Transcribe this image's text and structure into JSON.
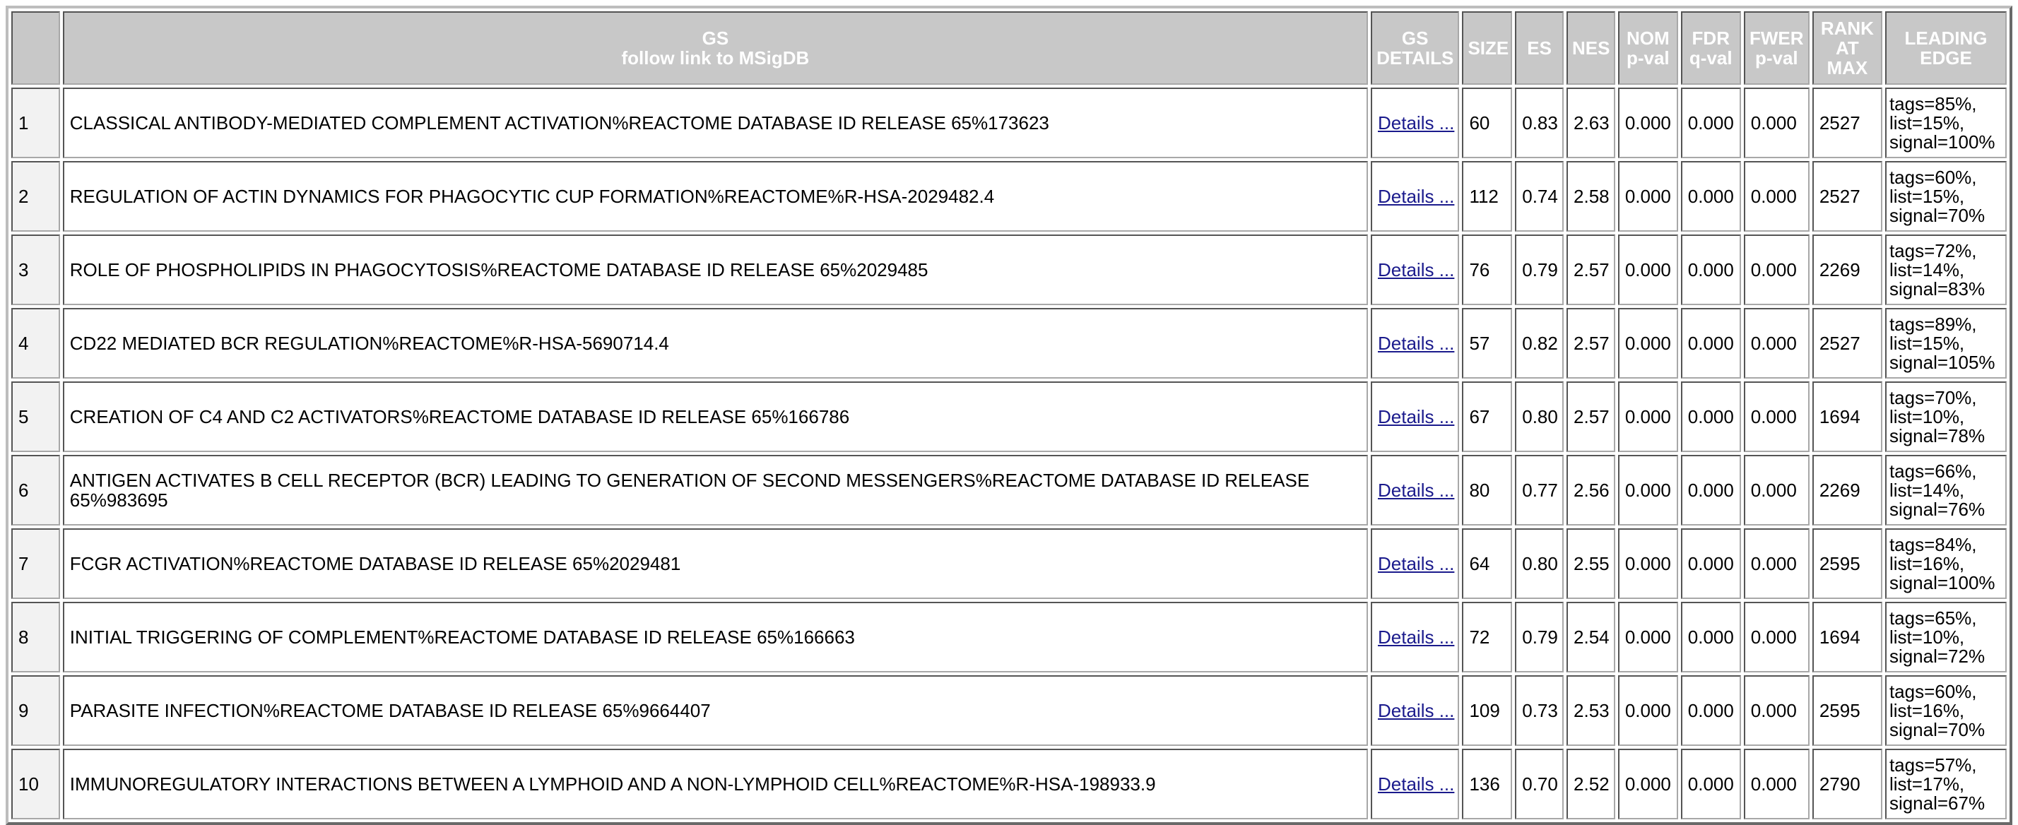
{
  "header": {
    "gs_line1": "GS",
    "gs_line2": "follow link to MSigDB",
    "details_line1": "GS",
    "details_line2": "DETAILS",
    "size": "SIZE",
    "es": "ES",
    "nes": "NES",
    "nom_line1": "NOM",
    "nom_line2": "p-val",
    "fdr_line1": "FDR",
    "fdr_line2": "q-val",
    "fwer_line1": "FWER",
    "fwer_line2": "p-val",
    "rank_line1": "RANK",
    "rank_line2": "AT",
    "rank_line3": "MAX",
    "edge_line1": "LEADING",
    "edge_line2": "EDGE"
  },
  "details_label": "Details ...",
  "rows": [
    {
      "rank": "1",
      "gs": "CLASSICAL ANTIBODY-MEDIATED COMPLEMENT ACTIVATION%REACTOME DATABASE ID RELEASE 65%173623",
      "size": "60",
      "es": "0.83",
      "nes": "2.63",
      "nom": "0.000",
      "fdr": "0.000",
      "fwer": "0.000",
      "rank_at_max": "2527",
      "tags": "tags=85%,",
      "list": "list=15%,",
      "signal": "signal=100%"
    },
    {
      "rank": "2",
      "gs": "REGULATION OF ACTIN DYNAMICS FOR PHAGOCYTIC CUP FORMATION%REACTOME%R-HSA-2029482.4",
      "size": "112",
      "es": "0.74",
      "nes": "2.58",
      "nom": "0.000",
      "fdr": "0.000",
      "fwer": "0.000",
      "rank_at_max": "2527",
      "tags": "tags=60%,",
      "list": "list=15%,",
      "signal": "signal=70%"
    },
    {
      "rank": "3",
      "gs": "ROLE OF PHOSPHOLIPIDS IN PHAGOCYTOSIS%REACTOME DATABASE ID RELEASE 65%2029485",
      "size": "76",
      "es": "0.79",
      "nes": "2.57",
      "nom": "0.000",
      "fdr": "0.000",
      "fwer": "0.000",
      "rank_at_max": "2269",
      "tags": "tags=72%,",
      "list": "list=14%,",
      "signal": "signal=83%"
    },
    {
      "rank": "4",
      "gs": "CD22 MEDIATED BCR REGULATION%REACTOME%R-HSA-5690714.4",
      "size": "57",
      "es": "0.82",
      "nes": "2.57",
      "nom": "0.000",
      "fdr": "0.000",
      "fwer": "0.000",
      "rank_at_max": "2527",
      "tags": "tags=89%,",
      "list": "list=15%,",
      "signal": "signal=105%"
    },
    {
      "rank": "5",
      "gs": "CREATION OF C4 AND C2 ACTIVATORS%REACTOME DATABASE ID RELEASE 65%166786",
      "size": "67",
      "es": "0.80",
      "nes": "2.57",
      "nom": "0.000",
      "fdr": "0.000",
      "fwer": "0.000",
      "rank_at_max": "1694",
      "tags": "tags=70%,",
      "list": "list=10%,",
      "signal": "signal=78%"
    },
    {
      "rank": "6",
      "gs": "ANTIGEN ACTIVATES B CELL RECEPTOR (BCR) LEADING TO GENERATION OF SECOND MESSENGERS%REACTOME DATABASE ID RELEASE 65%983695",
      "size": "80",
      "es": "0.77",
      "nes": "2.56",
      "nom": "0.000",
      "fdr": "0.000",
      "fwer": "0.000",
      "rank_at_max": "2269",
      "tags": "tags=66%,",
      "list": "list=14%,",
      "signal": "signal=76%"
    },
    {
      "rank": "7",
      "gs": "FCGR ACTIVATION%REACTOME DATABASE ID RELEASE 65%2029481",
      "size": "64",
      "es": "0.80",
      "nes": "2.55",
      "nom": "0.000",
      "fdr": "0.000",
      "fwer": "0.000",
      "rank_at_max": "2595",
      "tags": "tags=84%,",
      "list": "list=16%,",
      "signal": "signal=100%"
    },
    {
      "rank": "8",
      "gs": "INITIAL TRIGGERING OF COMPLEMENT%REACTOME DATABASE ID RELEASE 65%166663",
      "size": "72",
      "es": "0.79",
      "nes": "2.54",
      "nom": "0.000",
      "fdr": "0.000",
      "fwer": "0.000",
      "rank_at_max": "1694",
      "tags": "tags=65%,",
      "list": "list=10%,",
      "signal": "signal=72%"
    },
    {
      "rank": "9",
      "gs": "PARASITE INFECTION%REACTOME DATABASE ID RELEASE 65%9664407",
      "size": "109",
      "es": "0.73",
      "nes": "2.53",
      "nom": "0.000",
      "fdr": "0.000",
      "fwer": "0.000",
      "rank_at_max": "2595",
      "tags": "tags=60%,",
      "list": "list=16%,",
      "signal": "signal=70%"
    },
    {
      "rank": "10",
      "gs": "IMMUNOREGULATORY INTERACTIONS BETWEEN A LYMPHOID AND A NON-LYMPHOID CELL%REACTOME%R-HSA-198933.9",
      "size": "136",
      "es": "0.70",
      "nes": "2.52",
      "nom": "0.000",
      "fdr": "0.000",
      "fwer": "0.000",
      "rank_at_max": "2790",
      "tags": "tags=57%,",
      "list": "list=17%,",
      "signal": "signal=67%"
    }
  ]
}
